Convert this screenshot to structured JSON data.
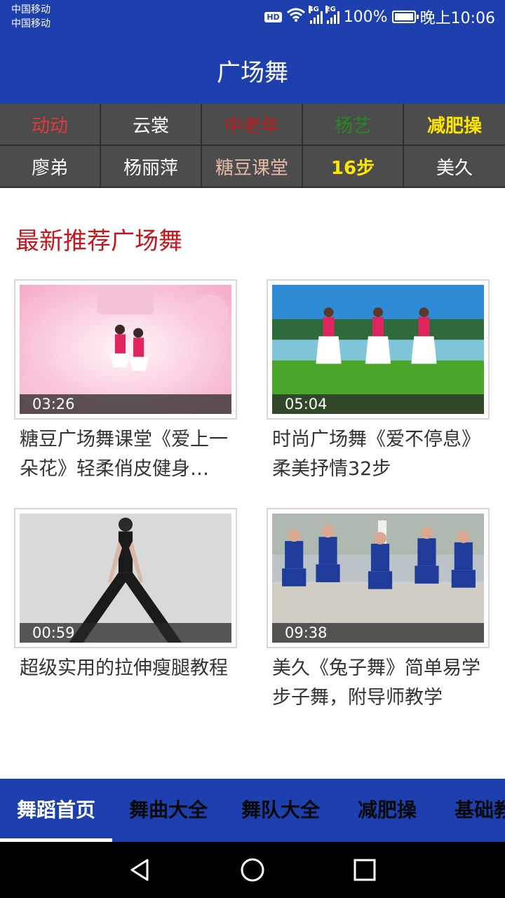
{
  "status_bar": {
    "carrier_1": "中国移动",
    "carrier_2": "中国移动",
    "hd_badge": "HD",
    "network_1": "4G",
    "network_2": "2G",
    "battery": "100%",
    "time": "晚上10:06"
  },
  "header": {
    "title": "广场舞"
  },
  "categories": [
    {
      "label": "动动",
      "color": "#e03a3a"
    },
    {
      "label": "云裳",
      "color": "#ffffff"
    },
    {
      "label": "中老年",
      "color": "#c41a1a"
    },
    {
      "label": "杨艺",
      "color": "#1f8a1f"
    },
    {
      "label": "减肥操",
      "color": "#ffe600"
    },
    {
      "label": "廖弟",
      "color": "#ffffff"
    },
    {
      "label": "杨丽萍",
      "color": "#ffffff"
    },
    {
      "label": "糖豆课堂",
      "color": "#e7b9a8"
    },
    {
      "label": "16步",
      "color": "#ffe600"
    },
    {
      "label": "美久",
      "color": "#ffffff"
    }
  ],
  "section": {
    "title": "最新推荐广场舞"
  },
  "videos": [
    {
      "duration": "03:26",
      "title": "糖豆广场舞课堂《爱上一朵花》轻柔俏皮健身…"
    },
    {
      "duration": "05:04",
      "title": "时尚广场舞《爱不停息》柔美抒情32步"
    },
    {
      "duration": "00:59",
      "title": "超级实用的拉伸瘦腿教程"
    },
    {
      "duration": "09:38",
      "title": "美久《兔子舞》简单易学步子舞，附导师教学"
    }
  ],
  "tabs": [
    {
      "label": "舞蹈首页",
      "active": true
    },
    {
      "label": "舞曲大全",
      "active": false
    },
    {
      "label": "舞队大全",
      "active": false
    },
    {
      "label": "减肥操",
      "active": false
    },
    {
      "label": "基础教",
      "active": false
    }
  ],
  "colors": {
    "primary": "#1e3fae",
    "section_title": "#c8151b",
    "category_bg": "#4c4c4c"
  }
}
